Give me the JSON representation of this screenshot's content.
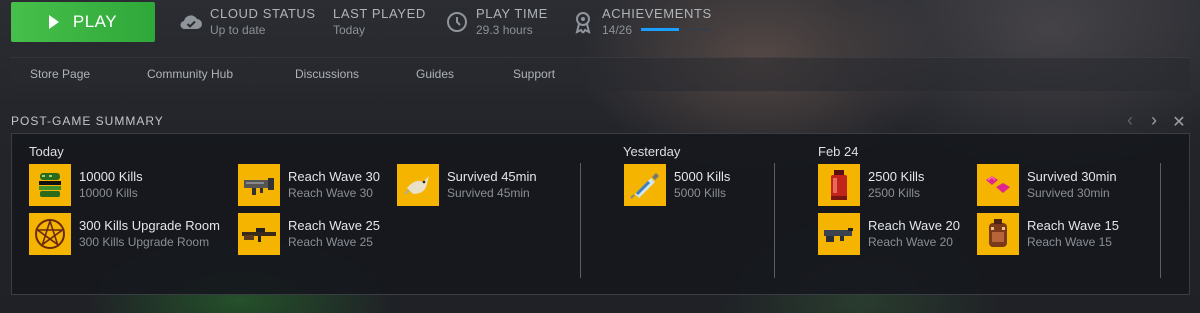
{
  "topbar": {
    "play_label": "PLAY",
    "cloud_status": {
      "label": "CLOUD STATUS",
      "value": "Up to date"
    },
    "last_played": {
      "label": "LAST PLAYED",
      "value": "Today"
    },
    "play_time": {
      "label": "PLAY TIME",
      "value": "29.3 hours"
    },
    "achievements": {
      "label": "ACHIEVEMENTS",
      "value": "14/26",
      "progress": 0.538
    }
  },
  "nav": [
    "Store Page",
    "Community Hub",
    "Discussions",
    "Guides",
    "Support"
  ],
  "summary": {
    "title": "POST-GAME SUMMARY",
    "groups": [
      {
        "label": "Today",
        "items": [
          {
            "name": "10000 Kills",
            "desc": "10000 Kills",
            "icon": "burger-icon"
          },
          {
            "name": "300 Kills Upgrade Room",
            "desc": "300 Kills Upgrade Room",
            "icon": "pentagram-icon"
          },
          {
            "name": "Reach Wave 30",
            "desc": "Reach Wave 30",
            "icon": "rocket-launcher-icon"
          },
          {
            "name": "Reach Wave 25",
            "desc": "Reach Wave 25",
            "icon": "sniper-rifle-icon"
          },
          {
            "name": "Survived 45min",
            "desc": "Survived 45min",
            "icon": "bird-icon"
          }
        ]
      },
      {
        "label": "Yesterday",
        "items": [
          {
            "name": "5000 Kills",
            "desc": "5000 Kills",
            "icon": "syringe-icon"
          }
        ]
      },
      {
        "label": "Feb 24",
        "items": [
          {
            "name": "2500 Kills",
            "desc": "2500 Kills",
            "icon": "red-potion-icon"
          },
          {
            "name": "Reach Wave 20",
            "desc": "Reach Wave 20",
            "icon": "shotgun-icon"
          },
          {
            "name": "Survived 30min",
            "desc": "Survived 30min",
            "icon": "gems-icon"
          },
          {
            "name": "Reach Wave 15",
            "desc": "Reach Wave 15",
            "icon": "backpack-icon"
          }
        ]
      }
    ]
  },
  "colors": {
    "play_green": "#47bf4a",
    "badge_yellow": "#f5b400",
    "progress_blue": "#1a9fff"
  }
}
